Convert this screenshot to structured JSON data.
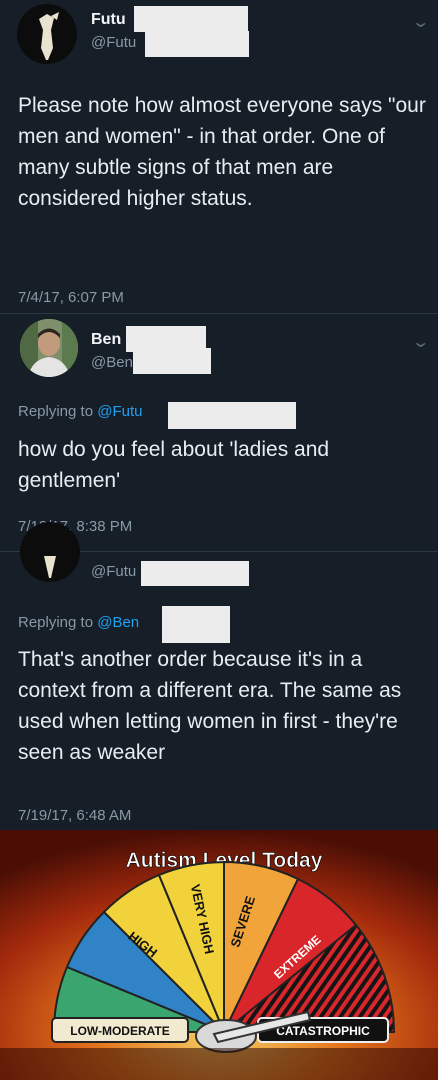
{
  "tweets": [
    {
      "name": "Futu",
      "handle": "@Futu",
      "text": "Please note how almost everyone says \"our men and women\" - in that order. One of many subtle signs of that men are considered higher status.",
      "time": "7/4/17, 6:07 PM"
    },
    {
      "name": "Ben",
      "handle": "@Ben",
      "reply_prefix": "Replying to ",
      "reply_to": "@Futu",
      "text": "how do you feel about 'ladies and gentlemen'",
      "time": "7/18/17, 8:38 PM"
    },
    {
      "handle": "@Futu",
      "reply_prefix": "Replying to ",
      "reply_to": "@Ben",
      "text": "That's another order because it's in a context from a different era. The same as used when letting women in first - they're seen as weaker",
      "time": "7/19/17, 6:48 AM"
    }
  ],
  "meme": {
    "title": "Autism Level Today",
    "levels": [
      {
        "label": "LOW-MODERATE",
        "color": "#3aa56e"
      },
      {
        "label": "HIGH",
        "color": "#2f83c6"
      },
      {
        "label": "VERY HIGH",
        "color": "#f1d23a"
      },
      {
        "label": "SEVERE",
        "color": "#f0a43a"
      },
      {
        "label": "EXTREME",
        "color": "#d8262a"
      },
      {
        "label": "CATASTROPHIC",
        "color": "#121212"
      }
    ]
  },
  "colors": {
    "background": "#161e27",
    "link": "#1da1f2",
    "muted": "#8899a6"
  }
}
